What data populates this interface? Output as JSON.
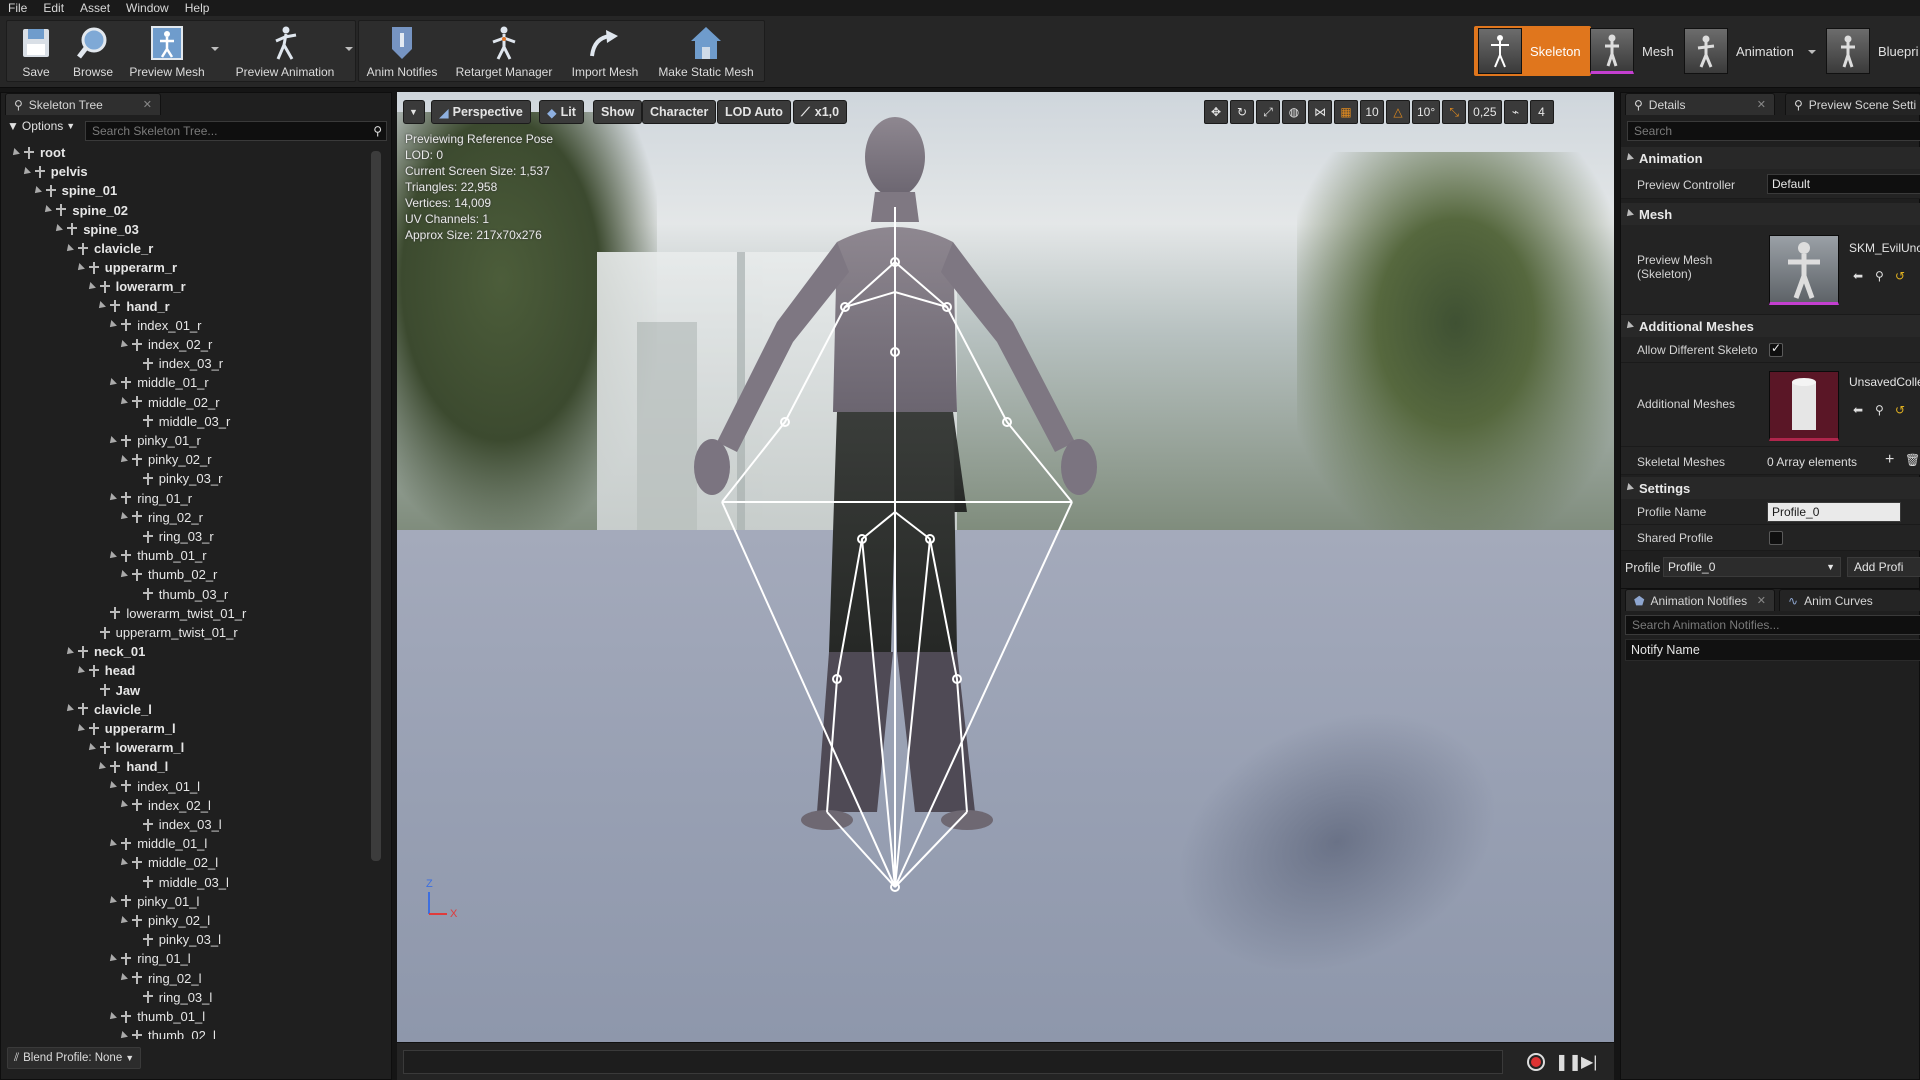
{
  "menu": [
    "File",
    "Edit",
    "Asset",
    "Window",
    "Help"
  ],
  "toolbar": {
    "save": "Save",
    "browse": "Browse",
    "preview_mesh": "Preview Mesh",
    "preview_animation": "Preview Animation",
    "anim_notifies": "Anim Notifies",
    "retarget_manager": "Retarget Manager",
    "import_mesh": "Import Mesh",
    "make_static_mesh": "Make Static Mesh"
  },
  "modes": {
    "skeleton": "Skeleton",
    "mesh": "Mesh",
    "animation": "Animation",
    "blueprint": "Bluepri"
  },
  "skeleton_tree": {
    "tab_title": "Skeleton Tree",
    "options_label": "Options",
    "search_placeholder": "Search Skeleton Tree...",
    "bones": [
      "root",
      "pelvis",
      "spine_01",
      "spine_02",
      "spine_03",
      "clavicle_r",
      "upperarm_r",
      "lowerarm_r",
      "hand_r",
      "index_01_r",
      "index_02_r",
      "index_03_r",
      "middle_01_r",
      "middle_02_r",
      "middle_03_r",
      "pinky_01_r",
      "pinky_02_r",
      "pinky_03_r",
      "ring_01_r",
      "ring_02_r",
      "ring_03_r",
      "thumb_01_r",
      "thumb_02_r",
      "thumb_03_r",
      "lowerarm_twist_01_r",
      "upperarm_twist_01_r",
      "neck_01",
      "head",
      "Jaw",
      "clavicle_l",
      "upperarm_l",
      "lowerarm_l",
      "hand_l",
      "index_01_l",
      "index_02_l",
      "index_03_l",
      "middle_01_l",
      "middle_02_l",
      "middle_03_l",
      "pinky_01_l",
      "pinky_02_l",
      "pinky_03_l",
      "ring_01_l",
      "ring_02_l",
      "ring_03_l",
      "thumb_01_l",
      "thumb_02_l"
    ],
    "blend_profile": "Blend Profile: None"
  },
  "viewport": {
    "buttons": {
      "perspective": "Perspective",
      "lit": "Lit",
      "show": "Show",
      "character": "Character",
      "lod": "LOD Auto",
      "speed": "x1,0"
    },
    "info": [
      "Previewing Reference Pose",
      "LOD: 0",
      "Current Screen Size: 1,537",
      "Triangles: 22,958",
      "Vertices: 14,009",
      "UV Channels: 1",
      "Approx Size: 217x70x276"
    ],
    "tools": {
      "grid_snap": "10",
      "rot_snap": "10°",
      "scale_snap": "0,25",
      "cam_speed": "4"
    },
    "axis_z": "Z",
    "axis_x": "X"
  },
  "details": {
    "tab_title": "Details",
    "tab2_title": "Preview Scene Setti",
    "search_placeholder": "Search",
    "sections": {
      "animation": "Animation",
      "mesh": "Mesh",
      "additional_meshes": "Additional Meshes",
      "settings": "Settings"
    },
    "preview_controller_label": "Preview Controller",
    "preview_controller_value": "Default",
    "preview_mesh_label": "Preview Mesh\n(Skeleton)",
    "preview_mesh_value": "SKM_EvilUnc",
    "allow_diff_label": "Allow Different Skeleto",
    "additional_meshes_label": "Additional Meshes",
    "additional_meshes_value": "UnsavedColle",
    "skeletal_meshes_label": "Skeletal Meshes",
    "skeletal_meshes_value": "0 Array elements",
    "profile_name_label": "Profile Name",
    "profile_name_value": "Profile_0",
    "shared_profile_label": "Shared Profile",
    "profile_label": "Profile",
    "profile_value": "Profile_0",
    "add_profile": "Add Profi"
  },
  "notifies": {
    "tab_title": "Animation Notifies",
    "tab2_title": "Anim Curves",
    "search_placeholder": "Search Animation Notifies...",
    "column": "Notify Name"
  }
}
